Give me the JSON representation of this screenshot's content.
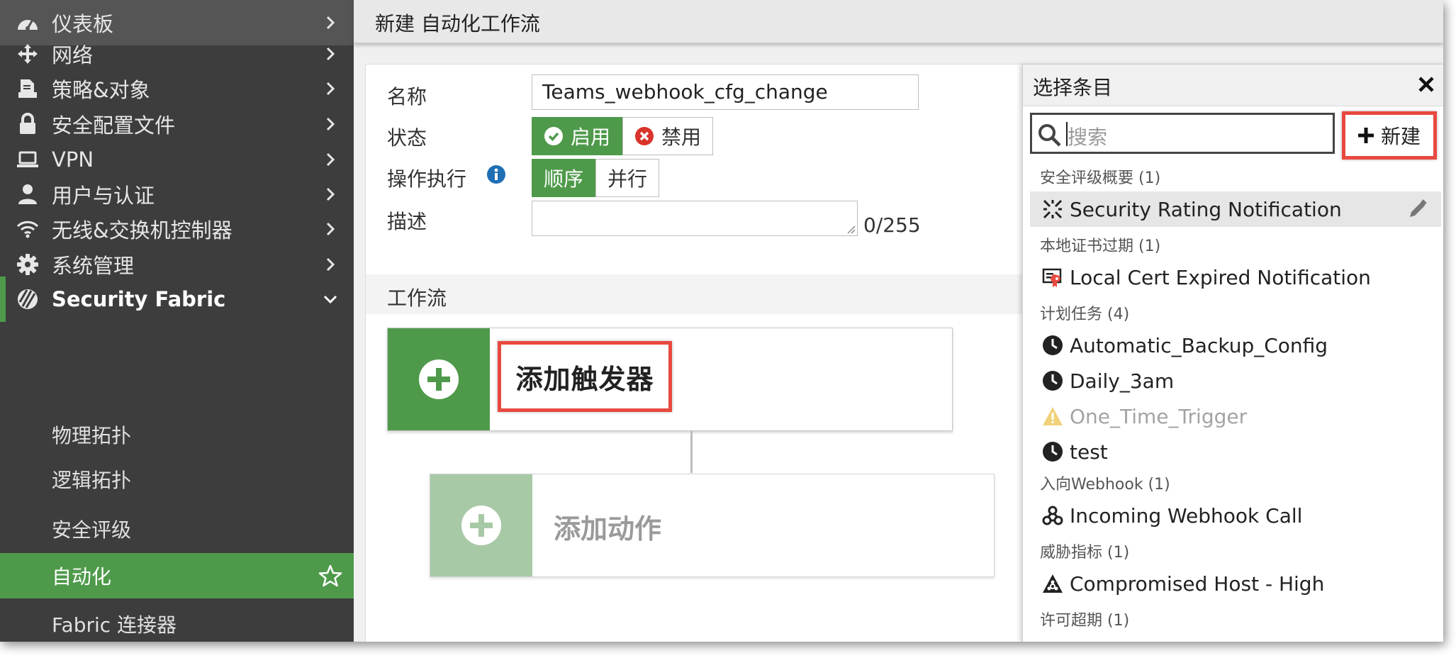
{
  "sidebar": {
    "items": [
      {
        "label": "仪表板",
        "icon": "dashboard-icon"
      },
      {
        "label": "网络",
        "icon": "network-icon"
      },
      {
        "label": "策略&对象",
        "icon": "policy-icon"
      },
      {
        "label": "安全配置文件",
        "icon": "lock-icon"
      },
      {
        "label": "VPN",
        "icon": "laptop-icon"
      },
      {
        "label": "用户与认证",
        "icon": "user-icon"
      },
      {
        "label": "无线&交换机控制器",
        "icon": "wifi-icon"
      },
      {
        "label": "系统管理",
        "icon": "gear-icon"
      },
      {
        "label": "Security Fabric",
        "icon": "fabric-icon"
      }
    ],
    "sub_items": [
      {
        "label": "物理拓扑"
      },
      {
        "label": "逻辑拓扑"
      },
      {
        "label": "安全评级"
      },
      {
        "label": "自动化"
      },
      {
        "label": "Fabric 连接器"
      }
    ]
  },
  "header": {
    "title": "新建 自动化工作流"
  },
  "form": {
    "name_label": "名称",
    "name_value": "Teams_webhook_cfg_change",
    "status_label": "状态",
    "status_enable": "启用",
    "status_disable": "禁用",
    "exec_label": "操作执行",
    "exec_sequential": "顺序",
    "exec_parallel": "并行",
    "desc_label": "描述",
    "desc_count": "0/255"
  },
  "workflow": {
    "section_title": "工作流",
    "add_trigger": "添加触发器",
    "add_action": "添加动作"
  },
  "panel": {
    "title": "选择条目",
    "search_placeholder": "搜索",
    "new_button": "新建",
    "categories": [
      {
        "label": "安全评级概要 (1)",
        "entries": [
          {
            "text": "Security Rating Notification",
            "icon": "security-rating-icon"
          }
        ]
      },
      {
        "label": "本地证书过期 (1)",
        "entries": [
          {
            "text": "Local Cert Expired Notification",
            "icon": "certificate-icon"
          }
        ]
      },
      {
        "label": "计划任务 (4)",
        "entries": [
          {
            "text": "Automatic_Backup_Config",
            "icon": "clock-icon"
          },
          {
            "text": "Daily_3am",
            "icon": "clock-icon"
          },
          {
            "text": "One_Time_Trigger",
            "icon": "warning-icon"
          },
          {
            "text": "test",
            "icon": "clock-icon"
          }
        ]
      },
      {
        "label": "入向Webhook (1)",
        "entries": [
          {
            "text": "Incoming Webhook Call",
            "icon": "webhook-icon"
          }
        ]
      },
      {
        "label": "威胁指标 (1)",
        "entries": [
          {
            "text": "Compromised Host - High",
            "icon": "biohazard-icon"
          }
        ]
      },
      {
        "label": "许可超期 (1)",
        "entries": []
      }
    ]
  },
  "colors": {
    "sidebar_bg": "#3d3d3d",
    "accent_green": "#4e9a4a",
    "highlight_red": "#e8493f",
    "info_blue": "#1f6fb5",
    "disable_red": "#d9342b"
  }
}
